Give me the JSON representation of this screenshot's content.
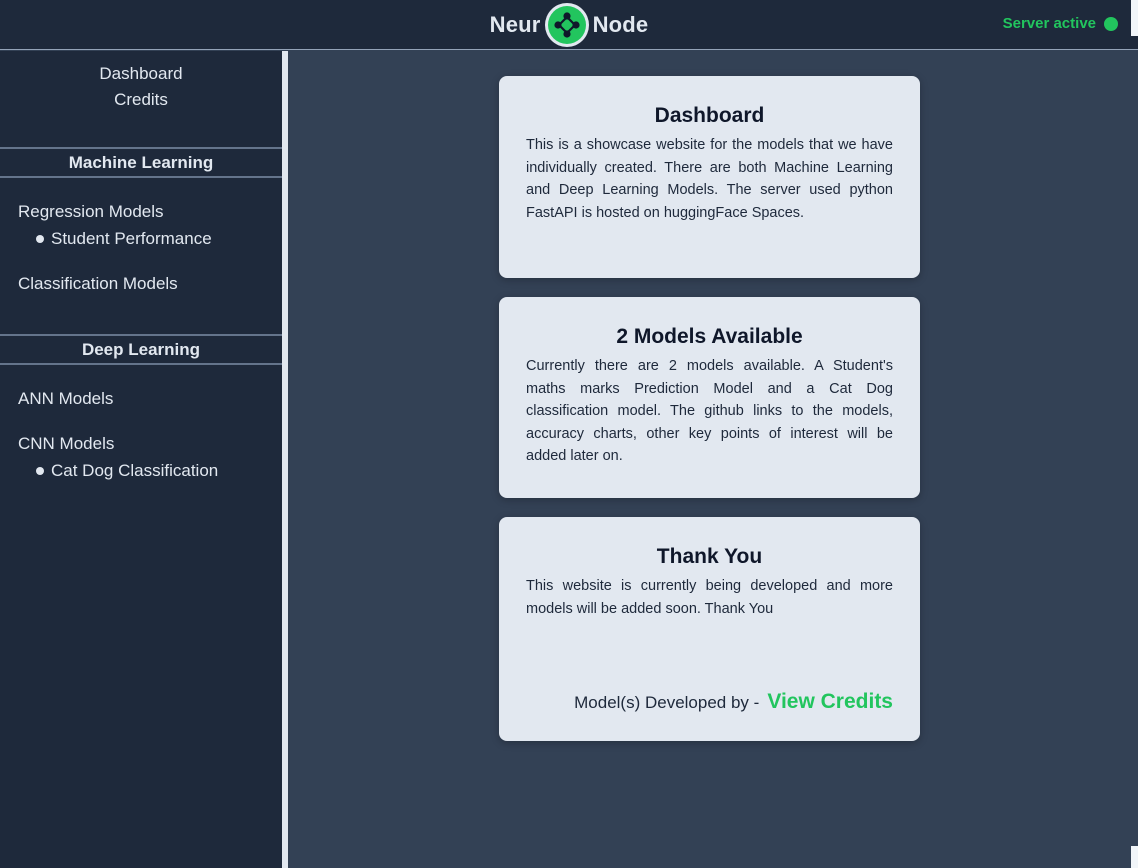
{
  "header": {
    "brand_left": "Neur",
    "brand_right": "Node",
    "server_status": "Server active"
  },
  "sidebar": {
    "top_links": [
      "Dashboard",
      "Credits"
    ],
    "machine_learning": {
      "title": "Machine Learning",
      "regression_title": "Regression Models",
      "regression_items": [
        "Student Performance"
      ],
      "classification_title": "Classification Models"
    },
    "deep_learning": {
      "title": "Deep Learning",
      "ann_title": "ANN Models",
      "cnn_title": "CNN Models",
      "cnn_items": [
        "Cat Dog Classification"
      ]
    }
  },
  "cards": [
    {
      "title": "Dashboard",
      "text": "This is a showcase website for the models that we have individually created. There are both Machine Learning and Deep Learning Models. The server used python FastAPI is hosted on huggingFace Spaces."
    },
    {
      "title": "2 Models Available",
      "text": "Currently there are 2 models available. A Student's maths marks Prediction Model and a Cat Dog classification model. The github links to the models, accuracy charts, other key points of interest will be added later on."
    },
    {
      "title": "Thank You",
      "text": "This website is currently being developed and more models will be added soon. Thank You",
      "credits_label": "Model(s) Developed by -",
      "credits_link": "View Credits"
    }
  ],
  "colors": {
    "accent": "#22c55e",
    "sidebar_bg": "#1e293b",
    "content_bg": "#334155",
    "card_bg": "#e2e8f0"
  },
  "icons": {
    "logo": "neural-node-logo-icon",
    "status": "status-dot-icon"
  }
}
